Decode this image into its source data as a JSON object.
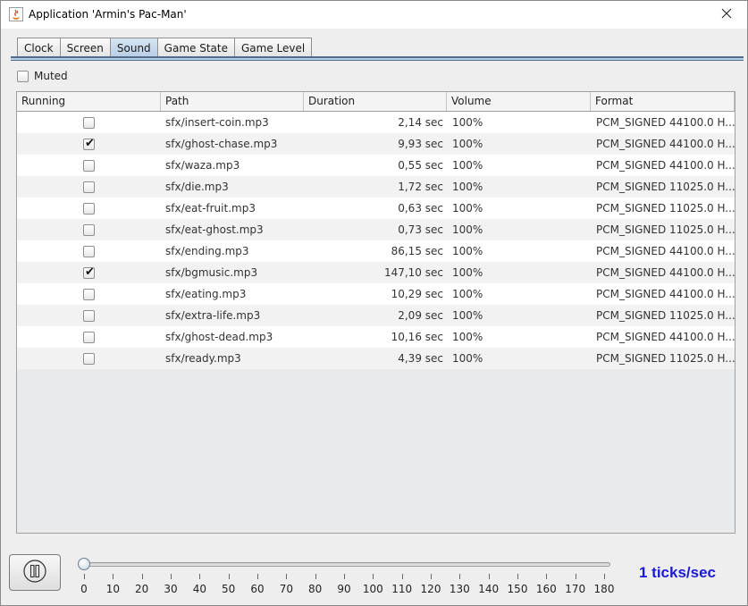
{
  "window": {
    "title": "Application 'Armin's Pac-Man'"
  },
  "tabs": [
    {
      "label": "Clock",
      "active": false
    },
    {
      "label": "Screen",
      "active": false
    },
    {
      "label": "Sound",
      "active": true
    },
    {
      "label": "Game State",
      "active": false
    },
    {
      "label": "Game Level",
      "active": false
    }
  ],
  "muted": {
    "label": "Muted",
    "checked": false
  },
  "table": {
    "columns": [
      "Running",
      "Path",
      "Duration",
      "Volume",
      "Format"
    ],
    "rows": [
      {
        "running": false,
        "path": "sfx/insert-coin.mp3",
        "duration": "2,14 sec",
        "volume": "100%",
        "format": "PCM_SIGNED 44100.0 H..."
      },
      {
        "running": true,
        "path": "sfx/ghost-chase.mp3",
        "duration": "9,93 sec",
        "volume": "100%",
        "format": "PCM_SIGNED 44100.0 H..."
      },
      {
        "running": false,
        "path": "sfx/waza.mp3",
        "duration": "0,55 sec",
        "volume": "100%",
        "format": "PCM_SIGNED 44100.0 H..."
      },
      {
        "running": false,
        "path": "sfx/die.mp3",
        "duration": "1,72 sec",
        "volume": "100%",
        "format": "PCM_SIGNED 11025.0 H..."
      },
      {
        "running": false,
        "path": "sfx/eat-fruit.mp3",
        "duration": "0,63 sec",
        "volume": "100%",
        "format": "PCM_SIGNED 11025.0 H..."
      },
      {
        "running": false,
        "path": "sfx/eat-ghost.mp3",
        "duration": "0,73 sec",
        "volume": "100%",
        "format": "PCM_SIGNED 11025.0 H..."
      },
      {
        "running": false,
        "path": "sfx/ending.mp3",
        "duration": "86,15 sec",
        "volume": "100%",
        "format": "PCM_SIGNED 44100.0 H..."
      },
      {
        "running": true,
        "path": "sfx/bgmusic.mp3",
        "duration": "147,10 sec",
        "volume": "100%",
        "format": "PCM_SIGNED 44100.0 H..."
      },
      {
        "running": false,
        "path": "sfx/eating.mp3",
        "duration": "10,29 sec",
        "volume": "100%",
        "format": "PCM_SIGNED 44100.0 H..."
      },
      {
        "running": false,
        "path": "sfx/extra-life.mp3",
        "duration": "2,09 sec",
        "volume": "100%",
        "format": "PCM_SIGNED 11025.0 H..."
      },
      {
        "running": false,
        "path": "sfx/ghost-dead.mp3",
        "duration": "10,16 sec",
        "volume": "100%",
        "format": "PCM_SIGNED 44100.0 H..."
      },
      {
        "running": false,
        "path": "sfx/ready.mp3",
        "duration": "4,39 sec",
        "volume": "100%",
        "format": "PCM_SIGNED 11025.0 H..."
      }
    ]
  },
  "controls": {
    "pause_icon": "pause-icon",
    "slider": {
      "value": 0,
      "min": 0,
      "max": 180,
      "tick_labels": [
        "0",
        "10",
        "20",
        "30",
        "40",
        "50",
        "60",
        "70",
        "80",
        "90",
        "100",
        "110",
        "120",
        "130",
        "140",
        "150",
        "160",
        "170",
        "180"
      ]
    },
    "speed_text": "1 ticks/sec"
  },
  "colors": {
    "speed_text": "#1a1ad8",
    "active_tab": "#b8cfe5"
  }
}
